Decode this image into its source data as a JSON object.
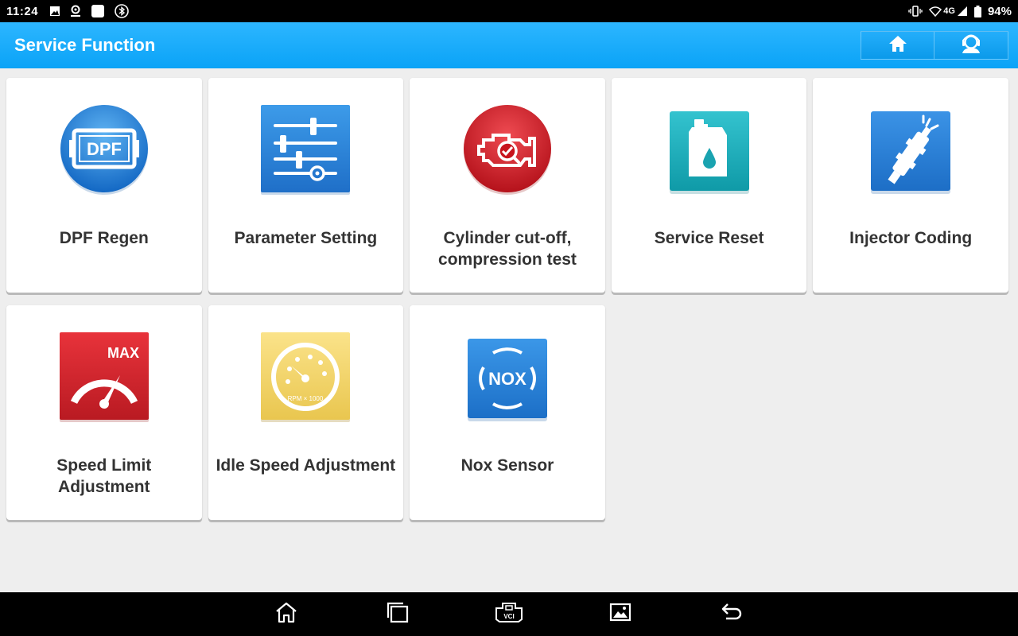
{
  "status_bar": {
    "time": "11:24",
    "network": "4G",
    "battery": "94%"
  },
  "app_bar": {
    "title": "Service Function",
    "home_icon": "home-icon",
    "support_icon": "support-agent-icon"
  },
  "functions": [
    {
      "label": "DPF Regen",
      "icon": "dpf-icon",
      "icon_text": "DPF"
    },
    {
      "label": "Parameter Setting",
      "icon": "parameter-sliders-icon"
    },
    {
      "label": "Cylinder cut-off, compression test",
      "icon": "engine-check-icon"
    },
    {
      "label": "Service Reset",
      "icon": "oil-can-icon"
    },
    {
      "label": "Injector Coding",
      "icon": "injector-icon"
    },
    {
      "label": "Speed Limit Adjustment",
      "icon": "speed-limit-gauge-icon",
      "icon_text": "MAX"
    },
    {
      "label": "Idle Speed Adjustment",
      "icon": "rpm-gauge-icon",
      "icon_text": "RPM × 1000"
    },
    {
      "label": "Nox Sensor",
      "icon": "nox-sensor-icon",
      "icon_text": "NOX"
    }
  ],
  "nav_bar": {
    "items": [
      "home-nav-icon",
      "recent-apps-icon",
      "vci-icon",
      "screenshot-icon",
      "back-icon"
    ]
  }
}
